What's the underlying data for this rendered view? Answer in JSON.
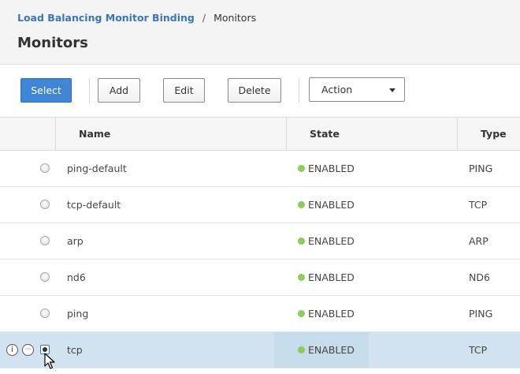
{
  "breadcrumb": {
    "parent": "Load Balancing Monitor Binding",
    "separator": "/",
    "current": "Monitors"
  },
  "page_title": "Monitors",
  "toolbar": {
    "select_label": "Select",
    "add_label": "Add",
    "edit_label": "Edit",
    "delete_label": "Delete",
    "action_label": "Action"
  },
  "table": {
    "columns": {
      "name": "Name",
      "state": "State",
      "type": "Type"
    },
    "rows": [
      {
        "name": "ping-default",
        "state": "ENABLED",
        "type": "PING",
        "selected": false
      },
      {
        "name": "tcp-default",
        "state": "ENABLED",
        "type": "TCP",
        "selected": false
      },
      {
        "name": "arp",
        "state": "ENABLED",
        "type": "ARP",
        "selected": false
      },
      {
        "name": "nd6",
        "state": "ENABLED",
        "type": "ND6",
        "selected": false
      },
      {
        "name": "ping",
        "state": "ENABLED",
        "type": "PING",
        "selected": false
      },
      {
        "name": "tcp",
        "state": "ENABLED",
        "type": "TCP",
        "selected": true
      }
    ],
    "row_icons": {
      "info": "i",
      "more": "···"
    }
  },
  "colors": {
    "accent": "#3f87d6",
    "link": "#3c76b9",
    "enabled": "#8ccc5e",
    "selected_row": "#d1e3f0"
  },
  "icons": {
    "info": "info-icon",
    "more": "more-icon",
    "caret": "chevron-down-icon",
    "status": "status-dot-icon",
    "cursor": "mouse-cursor-icon"
  }
}
